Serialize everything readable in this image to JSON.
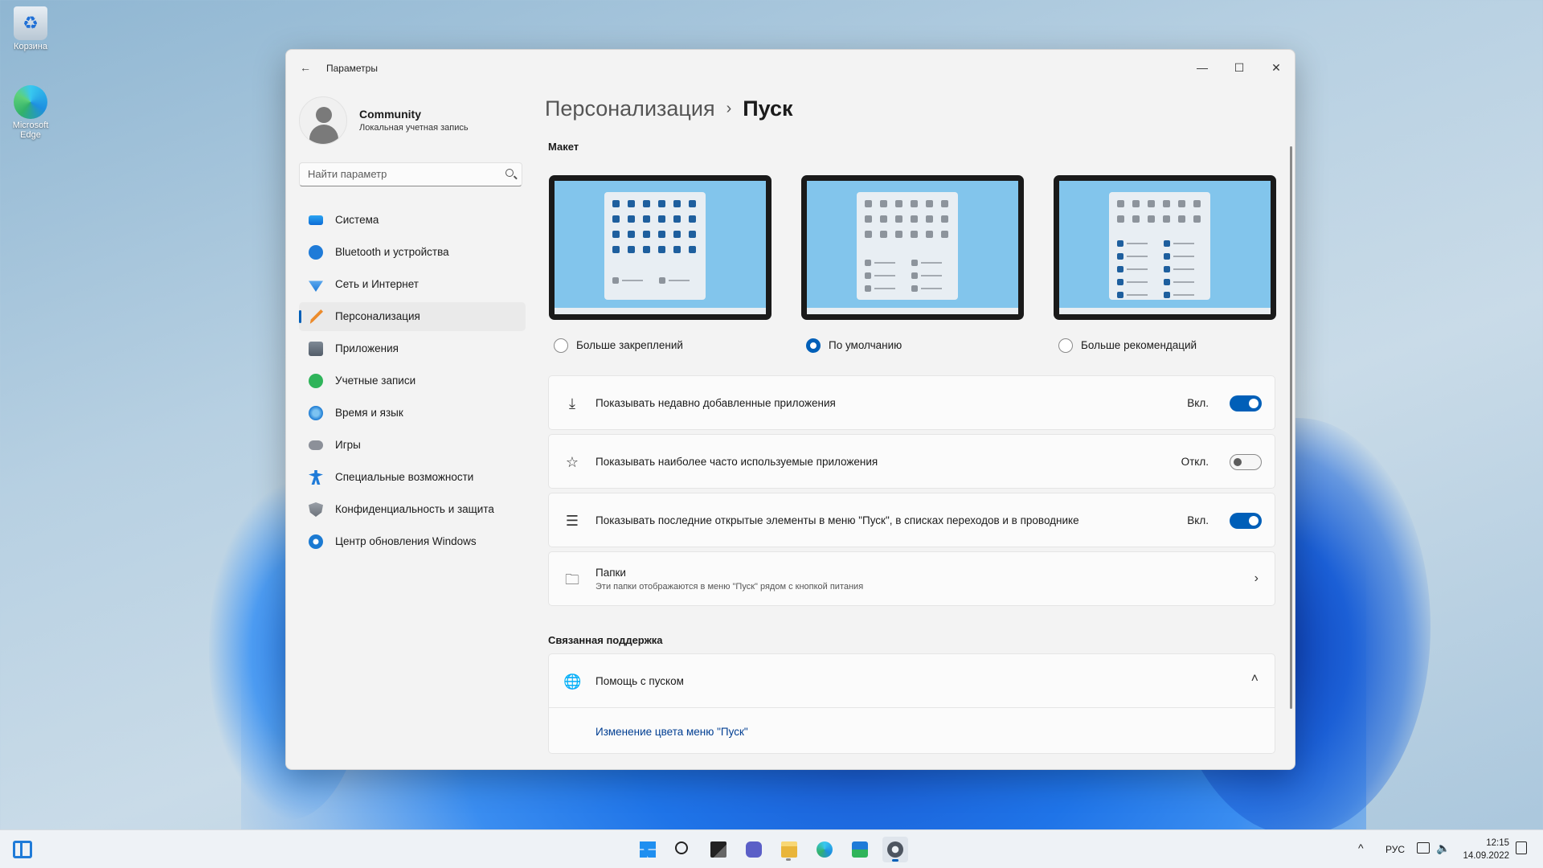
{
  "desktop": {
    "icons": [
      {
        "label": "Корзина",
        "icon": "recycle-bin-icon"
      },
      {
        "label": "Microsoft Edge",
        "icon": "edge-icon"
      }
    ]
  },
  "window": {
    "title": "Параметры",
    "controls": {
      "minimize": "—",
      "maximize": "☐",
      "close": "✕"
    }
  },
  "profile": {
    "name": "Community",
    "subtitle": "Локальная учетная запись"
  },
  "search": {
    "placeholder": "Найти параметр"
  },
  "sidebar": {
    "items": [
      {
        "label": "Система",
        "icon": "system-icon",
        "active": false
      },
      {
        "label": "Bluetooth и устройства",
        "icon": "bluetooth-icon",
        "active": false
      },
      {
        "label": "Сеть и Интернет",
        "icon": "network-icon",
        "active": false
      },
      {
        "label": "Персонализация",
        "icon": "brush-icon",
        "active": true
      },
      {
        "label": "Приложения",
        "icon": "apps-icon",
        "active": false
      },
      {
        "label": "Учетные записи",
        "icon": "accounts-icon",
        "active": false
      },
      {
        "label": "Время и язык",
        "icon": "time-language-icon",
        "active": false
      },
      {
        "label": "Игры",
        "icon": "gamepad-icon",
        "active": false
      },
      {
        "label": "Специальные возможности",
        "icon": "accessibility-icon",
        "active": false
      },
      {
        "label": "Конфиденциальность и защита",
        "icon": "shield-icon",
        "active": false
      },
      {
        "label": "Центр обновления Windows",
        "icon": "update-icon",
        "active": false
      }
    ]
  },
  "breadcrumb": {
    "parent": "Персонализация",
    "separator": "›",
    "current": "Пуск"
  },
  "layout_section": {
    "title": "Макет",
    "options": [
      {
        "label": "Больше закреплений",
        "selected": false
      },
      {
        "label": "По умолчанию",
        "selected": true
      },
      {
        "label": "Больше рекомендаций",
        "selected": false
      }
    ]
  },
  "settings": [
    {
      "label": "Показывать недавно добавленные приложения",
      "icon": "download-icon",
      "state_text": "Вкл.",
      "on": true
    },
    {
      "label": "Показывать наиболее часто используемые приложения",
      "icon": "star-icon",
      "state_text": "Откл.",
      "on": false
    },
    {
      "label": "Показывать последние открытые элементы в меню \"Пуск\", в списках переходов и в проводнике",
      "icon": "list-icon",
      "state_text": "Вкл.",
      "on": true
    }
  ],
  "folders": {
    "label": "Папки",
    "subtitle": "Эти папки отображаются в меню \"Пуск\" рядом с кнопкой питания"
  },
  "support": {
    "title": "Связанная поддержка",
    "help_label": "Помощь с пуском",
    "link": "Изменение цвета меню \"Пуск\""
  },
  "taskbar": {
    "apps": [
      "start-icon",
      "search-icon",
      "task-view-icon",
      "chat-icon",
      "file-explorer-icon",
      "edge-icon",
      "store-icon",
      "settings-icon"
    ],
    "tray": {
      "chevron": "^",
      "language": "РУС",
      "time": "12:15",
      "date": "14.09.2022"
    }
  },
  "colors": {
    "accent": "#005fb8",
    "window_bg": "#f3f3f3",
    "card_bg": "#fbfbfb",
    "link": "#003e92"
  }
}
